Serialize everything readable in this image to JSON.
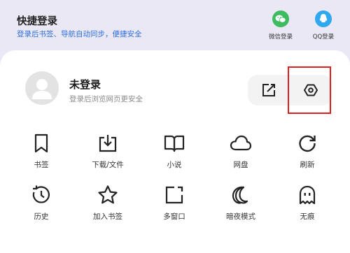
{
  "banner": {
    "title": "快捷登录",
    "subtitle": "登录后书签、导航自动同步，便捷安全",
    "options": [
      {
        "label": "微信登录",
        "icon": "wechat-icon",
        "color": "#3dbb5e"
      },
      {
        "label": "QQ登录",
        "icon": "qq-icon",
        "color": "#2fa8f0"
      }
    ]
  },
  "user": {
    "name": "未登录",
    "subtitle": "登录后浏览网页更安全",
    "avatar_icon": "avatar-icon"
  },
  "actions": [
    {
      "icon": "edit-icon"
    },
    {
      "icon": "settings-icon"
    }
  ],
  "grid": [
    {
      "label": "书签",
      "icon": "bookmark-icon"
    },
    {
      "label": "下载/文件",
      "icon": "download-icon"
    },
    {
      "label": "小说",
      "icon": "book-icon"
    },
    {
      "label": "网盘",
      "icon": "cloud-icon"
    },
    {
      "label": "刷新",
      "icon": "refresh-icon"
    },
    {
      "label": "历史",
      "icon": "history-icon"
    },
    {
      "label": "加入书签",
      "icon": "star-icon"
    },
    {
      "label": "多窗口",
      "icon": "windows-icon"
    },
    {
      "label": "暗夜模式",
      "icon": "moon-icon"
    },
    {
      "label": "无痕",
      "icon": "ghost-icon"
    }
  ],
  "colors": {
    "highlight": "#e02020",
    "accent": "#2f6fe0"
  }
}
